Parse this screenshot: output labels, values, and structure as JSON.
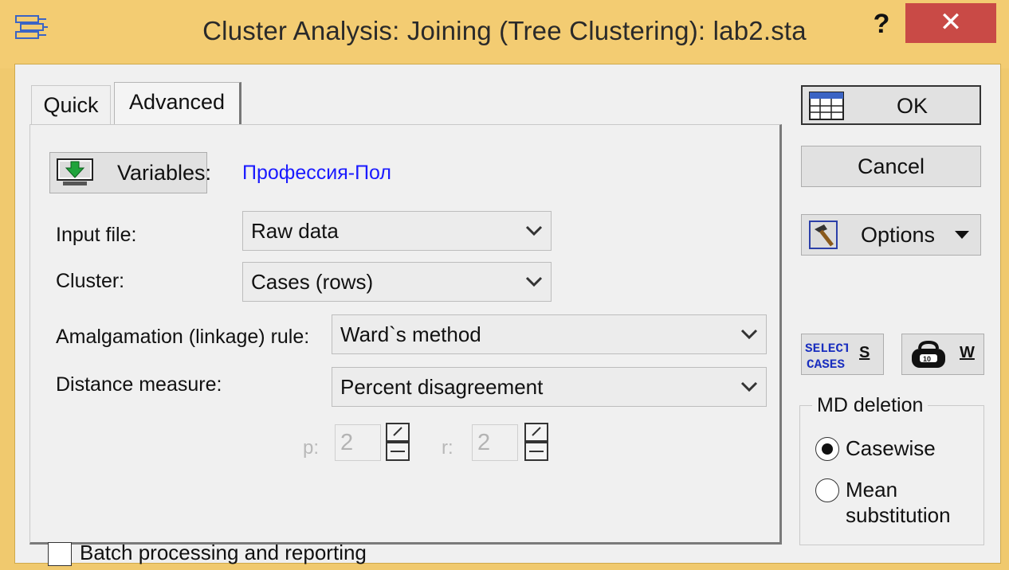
{
  "window": {
    "title": "Cluster Analysis: Joining (Tree Clustering): lab2.sta",
    "help_label": "?",
    "close_label": "✕"
  },
  "tabs": [
    {
      "label": "Quick",
      "active": false
    },
    {
      "label": "Advanced",
      "active": true
    }
  ],
  "variables": {
    "button_label": "Variables:",
    "selected": "Профессия-Пол"
  },
  "fields": {
    "input_file": {
      "label": "Input file:",
      "value": "Raw data"
    },
    "cluster": {
      "label": "Cluster:",
      "value": "Cases (rows)"
    },
    "amalgamation": {
      "label": "Amalgamation (linkage) rule:",
      "value": "Ward`s method"
    },
    "distance": {
      "label": "Distance measure:",
      "value": "Percent disagreement"
    }
  },
  "params": {
    "p_label": "p:",
    "p_value": "2",
    "r_label": "r:",
    "r_value": "2"
  },
  "batch": {
    "label": "Batch processing and reporting",
    "checked": false
  },
  "actions": {
    "ok_label": "OK",
    "cancel_label": "Cancel",
    "options_label": "Options",
    "select_cases_icon_text": "SELECT CASES",
    "select_cases_key": "S",
    "weight_key": "W"
  },
  "md_deletion": {
    "title": "MD deletion",
    "options": [
      {
        "label": "Casewise",
        "selected": true
      },
      {
        "label_line1": "Mean",
        "label_line2": "substitution",
        "selected": false
      }
    ]
  },
  "colors": {
    "frame": "#f0c96e",
    "close": "#c94a46",
    "link": "#1a1aff"
  }
}
